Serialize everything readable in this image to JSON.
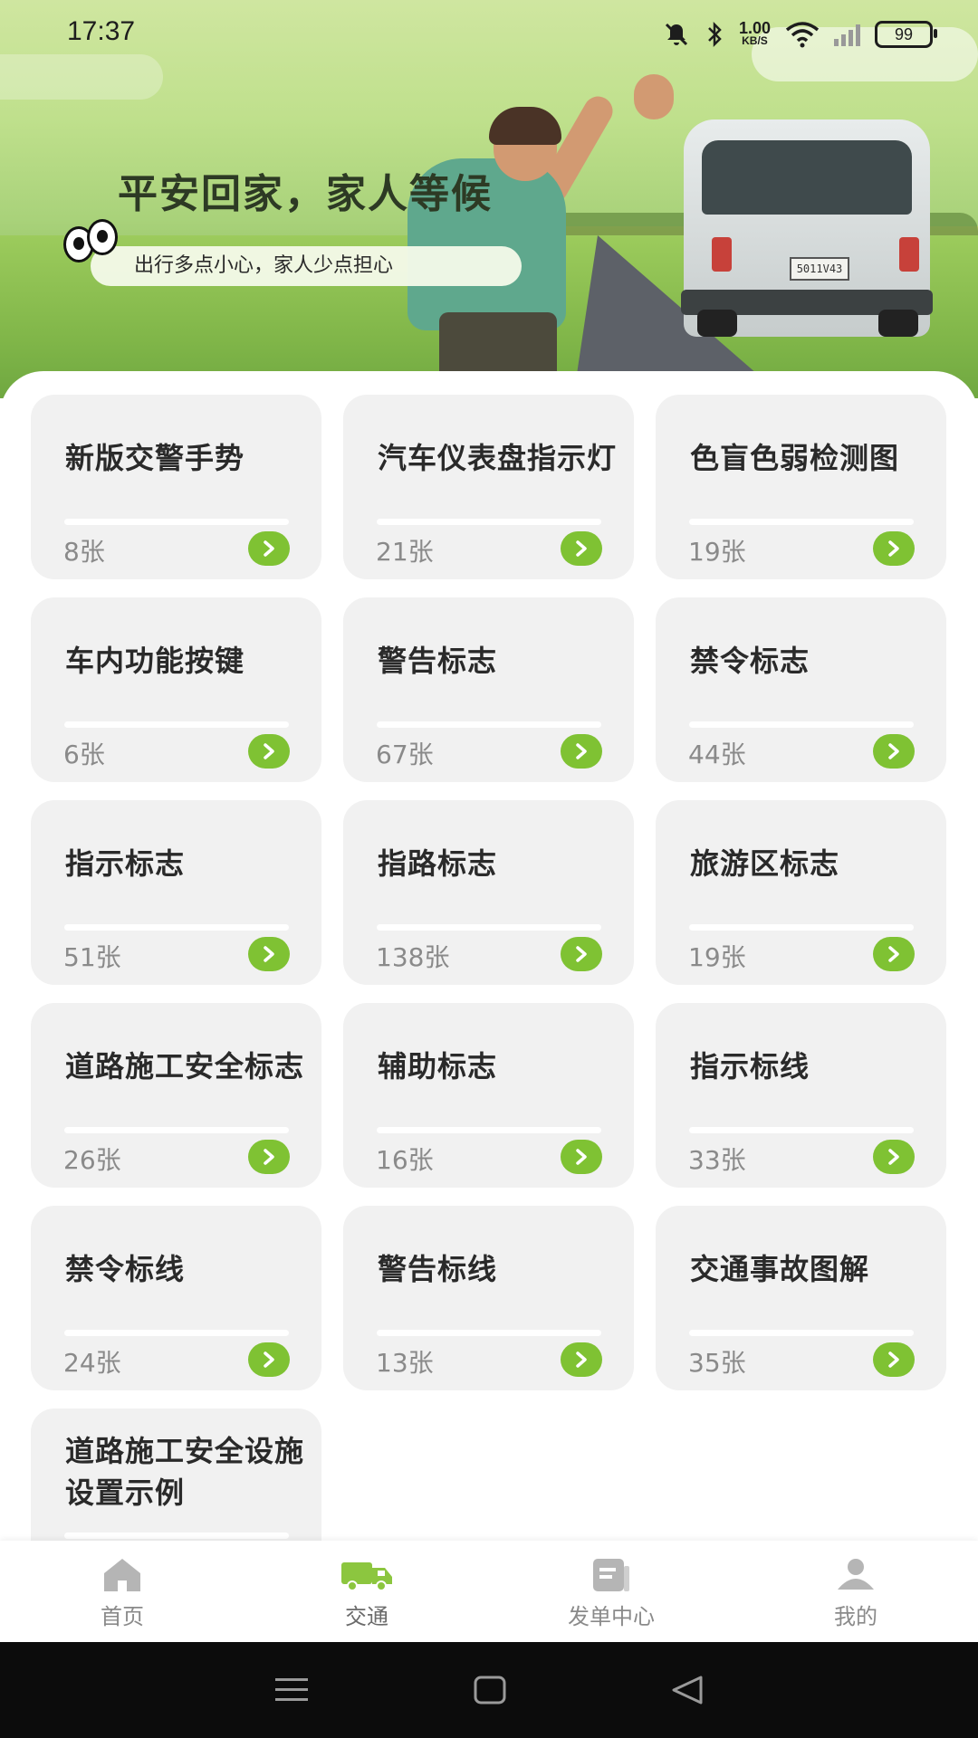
{
  "status_bar": {
    "time": "17:37",
    "net_speed": "1.00",
    "net_unit": "KB/S",
    "battery": "99",
    "icons": [
      "mute-icon",
      "bluetooth-icon",
      "wifi-icon",
      "signal-icon",
      "battery-icon"
    ]
  },
  "banner": {
    "headline": "平安回家，家人等候",
    "subtitle": "出行多点小心，家人少点担心",
    "plate": "5011V43"
  },
  "cards": [
    {
      "title": "新版交警手势",
      "count": "8张"
    },
    {
      "title": "汽车仪表盘指示灯",
      "count": "21张"
    },
    {
      "title": "色盲色弱检测图",
      "count": "19张"
    },
    {
      "title": "车内功能按键",
      "count": "6张"
    },
    {
      "title": "警告标志",
      "count": "67张"
    },
    {
      "title": "禁令标志",
      "count": "44张"
    },
    {
      "title": "指示标志",
      "count": "51张"
    },
    {
      "title": "指路标志",
      "count": "138张"
    },
    {
      "title": "旅游区标志",
      "count": "19张"
    },
    {
      "title": "道路施工安全标志",
      "count": "26张"
    },
    {
      "title": "辅助标志",
      "count": "16张"
    },
    {
      "title": "指示标线",
      "count": "33张"
    },
    {
      "title": "禁令标线",
      "count": "24张"
    },
    {
      "title": "警告标线",
      "count": "13张"
    },
    {
      "title": "交通事故图解",
      "count": "35张"
    },
    {
      "title": "道路施工安全设施设置示例",
      "count": ""
    }
  ],
  "bottom_nav": [
    {
      "label": "首页",
      "icon": "home-icon",
      "active": false
    },
    {
      "label": "交通",
      "icon": "truck-icon",
      "active": true
    },
    {
      "label": "发单中心",
      "icon": "document-icon",
      "active": false
    },
    {
      "label": "我的",
      "icon": "user-icon",
      "active": false
    }
  ],
  "colors": {
    "accent_green": "#7fc233",
    "card_bg": "#f1f1f1",
    "nav_active": "#8cc63f",
    "nav_inactive": "#b5b5b5"
  }
}
